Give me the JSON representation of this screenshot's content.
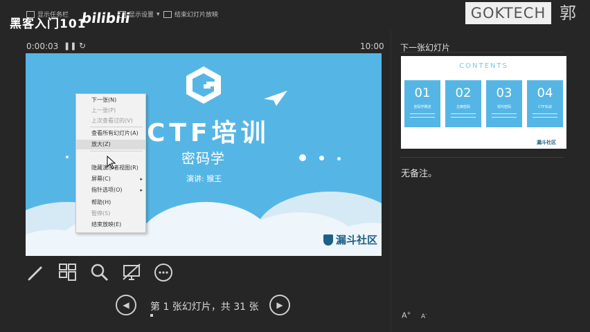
{
  "topbar": {
    "show_taskbar": "显示任务栏",
    "display_settings": "显示设置",
    "end_show": "结束幻灯片放映"
  },
  "overlay": {
    "title": "黑客入门101",
    "bilibili": "bilibili"
  },
  "brand": {
    "box_text": "GOKTECH",
    "char": "郭"
  },
  "presenter": {
    "elapsed": "0:00:03",
    "clock": "10:00",
    "next_slide_label": "下一张幻灯片",
    "notes": "无备注。",
    "slide_counter": "第 1 张幻灯片，共 31 张",
    "current_slide": 1,
    "total_slides": 31
  },
  "slide": {
    "title": "CTF培训",
    "subtitle": "密码学",
    "presenter_line": "演讲: 猴王",
    "logo_text": "漏斗社区"
  },
  "context_menu": {
    "items": [
      {
        "label": "下一张(N)",
        "enabled": true
      },
      {
        "label": "上一张(P)",
        "enabled": false
      },
      {
        "label": "上次查看过的(V)",
        "enabled": false
      },
      {
        "label": "查看所有幻灯片(A)",
        "enabled": true
      },
      {
        "label": "放大(Z)",
        "enabled": true
      },
      {
        "label": "隐藏演示者视图(R)",
        "enabled": true
      },
      {
        "label": "屏幕(C)",
        "enabled": true
      },
      {
        "label": "指针选项(O)",
        "enabled": true
      },
      {
        "label": "帮助(H)",
        "enabled": true
      },
      {
        "label": "暂停(S)",
        "enabled": false
      },
      {
        "label": "结束放映(E)",
        "enabled": true
      }
    ]
  },
  "next_thumb": {
    "title": "CONTENTS",
    "cards": [
      {
        "num": "01",
        "label": "密码学概述"
      },
      {
        "num": "02",
        "label": "古典密码"
      },
      {
        "num": "03",
        "label": "现代密码"
      },
      {
        "num": "04",
        "label": "CTF实战"
      }
    ],
    "logo_text": "漏斗社区"
  },
  "tools": [
    "pen-icon",
    "slides-grid-icon",
    "zoom-icon",
    "black-screen-icon",
    "more-options-icon"
  ],
  "font_buttons": {
    "increase": "A",
    "decrease": "A"
  },
  "colors": {
    "slide_bg": "#55b6e6",
    "app_bg": "#262626",
    "text": "#d8d8d8"
  }
}
